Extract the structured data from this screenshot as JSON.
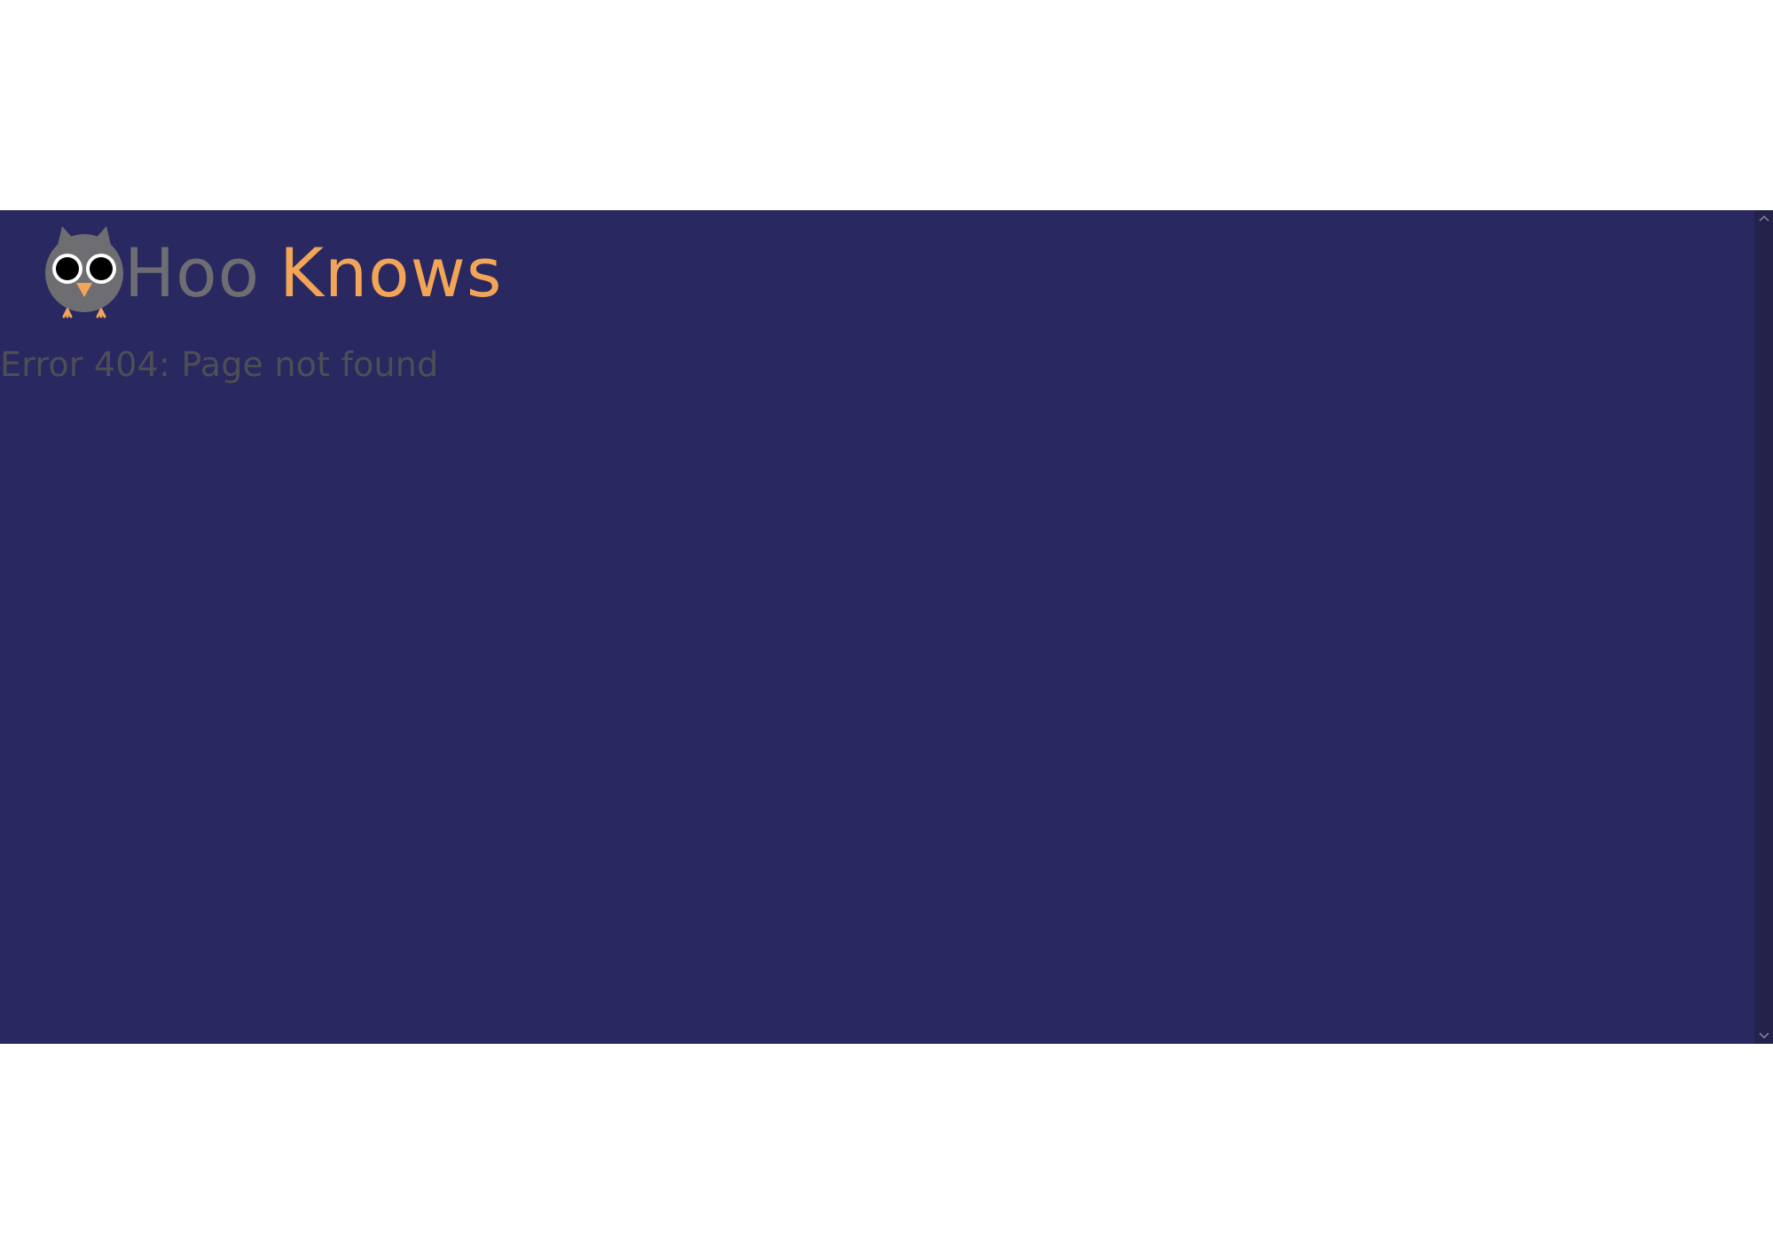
{
  "brand": {
    "name_part1": "Hoo",
    "name_part2": "Knows",
    "logo_icon": "owl-icon"
  },
  "message": {
    "error_text": "Error 404: Page not found"
  },
  "scrollbar": {
    "up_icon": "chevron-up-icon",
    "down_icon": "chevron-down-icon"
  },
  "colors": {
    "background": "#292861",
    "brand_gray": "#6e6e72",
    "brand_orange": "#f3a557",
    "error_text": "#4e4e55"
  }
}
